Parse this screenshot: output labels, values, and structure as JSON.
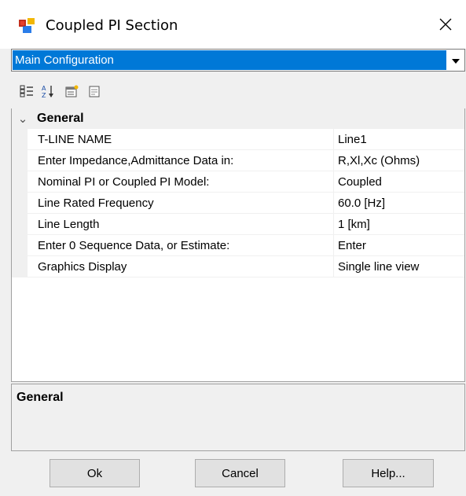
{
  "window": {
    "title": "Coupled PI Section",
    "close_glyph": "✕"
  },
  "config_select": {
    "selected": "Main Configuration"
  },
  "toolbar": {
    "icons": [
      "categorized-icon",
      "alphabetical-icon",
      "property-pages-icon",
      "events-icon"
    ]
  },
  "property_grid": {
    "category": "General",
    "category_toggle": "⌄",
    "rows": [
      {
        "name": "T-LINE NAME",
        "value": "Line1"
      },
      {
        "name": "Enter Impedance,Admittance Data in:",
        "value": "R,Xl,Xc (Ohms)"
      },
      {
        "name": "Nominal PI or Coupled PI Model:",
        "value": "Coupled"
      },
      {
        "name": "Line Rated Frequency",
        "value": "60.0 [Hz]"
      },
      {
        "name": "Line Length",
        "value": "1 [km]"
      },
      {
        "name": "Enter 0 Sequence Data, or Estimate:",
        "value": "Enter"
      },
      {
        "name": "Graphics Display",
        "value": "Single line view"
      }
    ]
  },
  "description": {
    "title": "General"
  },
  "buttons": {
    "ok": "Ok",
    "cancel": "Cancel",
    "help": "Help..."
  },
  "colors": {
    "selection_blue": "#0078d7",
    "background": "#f0f0f0"
  }
}
